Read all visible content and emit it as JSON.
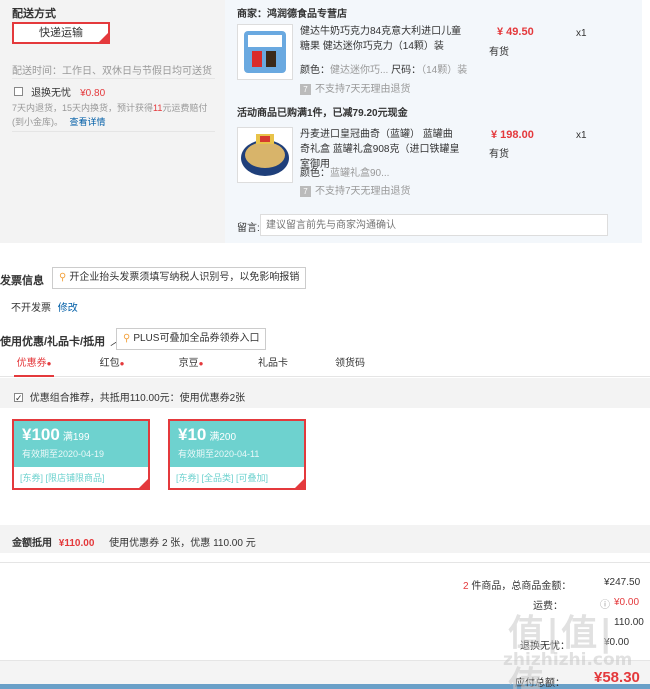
{
  "shipping": {
    "title": "配送方式",
    "method_button": "快递运输",
    "delivery_time": "配送时间：工作日、双休日与节假日均可送货",
    "return_insurance_label": "退换无忧",
    "return_insurance_price": "¥0.80",
    "return_desc_1": "7天内退货，15天内换货，预计获得",
    "return_desc_amount": "11",
    "return_desc_2": "元运费赔付",
    "return_desc_3": "(到小金库)。",
    "detail_link": "查看详情"
  },
  "order": {
    "merchant": "商家：鸿润德食品专营店",
    "items": [
      {
        "name": "健达牛奶巧克力84克意大利进口儿童糖果 健达迷你巧克力（14颗）装",
        "price": "¥ 49.50",
        "stock": "有货",
        "qty": "x1",
        "attr_color_label": "颜色：",
        "attr_color": "健达迷你巧...",
        "attr_size_label": "尺码：",
        "attr_size": "（14颗）装",
        "no_return": "不支持7天无理由退货"
      },
      {
        "name": "丹麦进口皇冠曲奇（蓝罐） 蓝罐曲奇礼盒 蓝罐礼盒908克（进口铁罐皇室御用",
        "price": "¥ 198.00",
        "stock": "有货",
        "qty": "x1",
        "attr_color_label": "颜色：",
        "attr_color": "蓝罐礼盒90...",
        "no_return": "不支持7天无理由退货"
      }
    ],
    "promo_text": "活动商品已购满1件，已减79.20元现金",
    "message_label": "留言:",
    "message_placeholder": "建议留言前先与商家沟通确认"
  },
  "invoice": {
    "title": "发票信息",
    "tip": "开企业抬头发票须填写纳税人识别号，以免影响报销",
    "status": "不开发票",
    "edit_link": "修改"
  },
  "discount": {
    "title": "使用优惠/礼品卡/抵用",
    "plus_tip": "PLUS可叠加全品券领券入口",
    "tabs": [
      "优惠券",
      "红包",
      "京豆",
      "礼品卡",
      "领货码"
    ],
    "combo_text": "优惠组合推荐，共抵用110.00元：使用优惠券2张",
    "coupons": [
      {
        "amount": "¥100",
        "condition": "满199",
        "valid": "有效期至2020-04-19",
        "tags": "[东券] [限店铺限商品]"
      },
      {
        "amount": "¥10",
        "condition": "满200",
        "valid": "有效期至2020-04-11",
        "tags": "[东券] [全品类] [可叠加]"
      }
    ],
    "deduct_label": "金额抵用",
    "deduct_amount": "¥110.00",
    "deduct_desc": "使用优惠券 2 张，优惠 110.00 元"
  },
  "summary": {
    "items_count": "2",
    "items_text": "件商品，总商品金额：",
    "items_total": "¥247.50",
    "freight_label": "运费：",
    "freight_value": "¥0.00",
    "partial_value_1": "110.00",
    "partial_label_2": "退换无忧：",
    "partial_value_2": "¥0.00",
    "payable_label": "应付总额：",
    "payable_value": "¥58.30"
  },
  "watermark": {
    "glyphs": "值|值|值",
    "domain": "zhizhizhi.com"
  },
  "colors": {
    "accent": "#e4393c",
    "coupon_teal": "#6ed2cf",
    "link": "#005ea7"
  }
}
